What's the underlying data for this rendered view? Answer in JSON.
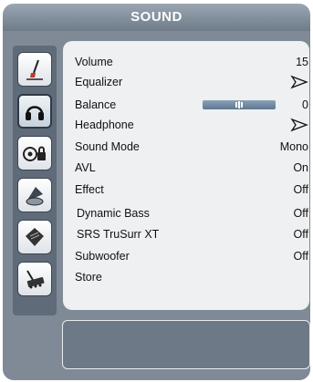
{
  "title": "SOUND",
  "sidebar": {
    "items": [
      {
        "icon": "picture-brush-icon",
        "active": false
      },
      {
        "icon": "headphone-sound-icon",
        "active": true
      },
      {
        "icon": "lock-settings-icon",
        "active": false
      },
      {
        "icon": "satellite-dish-icon",
        "active": false
      },
      {
        "icon": "document-notebook-icon",
        "active": false
      },
      {
        "icon": "network-plug-icon",
        "active": false
      }
    ]
  },
  "menu": {
    "volume": {
      "label": "Volume",
      "value": "15"
    },
    "equalizer": {
      "label": "Equalizer"
    },
    "balance": {
      "label": "Balance",
      "value": "0",
      "level": 0.5
    },
    "headphone": {
      "label": "Headphone"
    },
    "sound_mode": {
      "label": "Sound Mode",
      "value": "Mono"
    },
    "avl": {
      "label": "AVL",
      "value": "On"
    },
    "effect": {
      "label": "Effect",
      "value": "Off"
    },
    "dynamic_bass": {
      "label": "Dynamic Bass",
      "value": "Off"
    },
    "srs": {
      "label": "SRS TruSurr XT",
      "value": "Off"
    },
    "subwoofer": {
      "label": "Subwoofer",
      "value": "Off"
    },
    "store": {
      "label": "Store"
    }
  },
  "colors": {
    "frame": "#7f8a96",
    "panel": "#eef0f2",
    "accent": "#5f7890"
  }
}
